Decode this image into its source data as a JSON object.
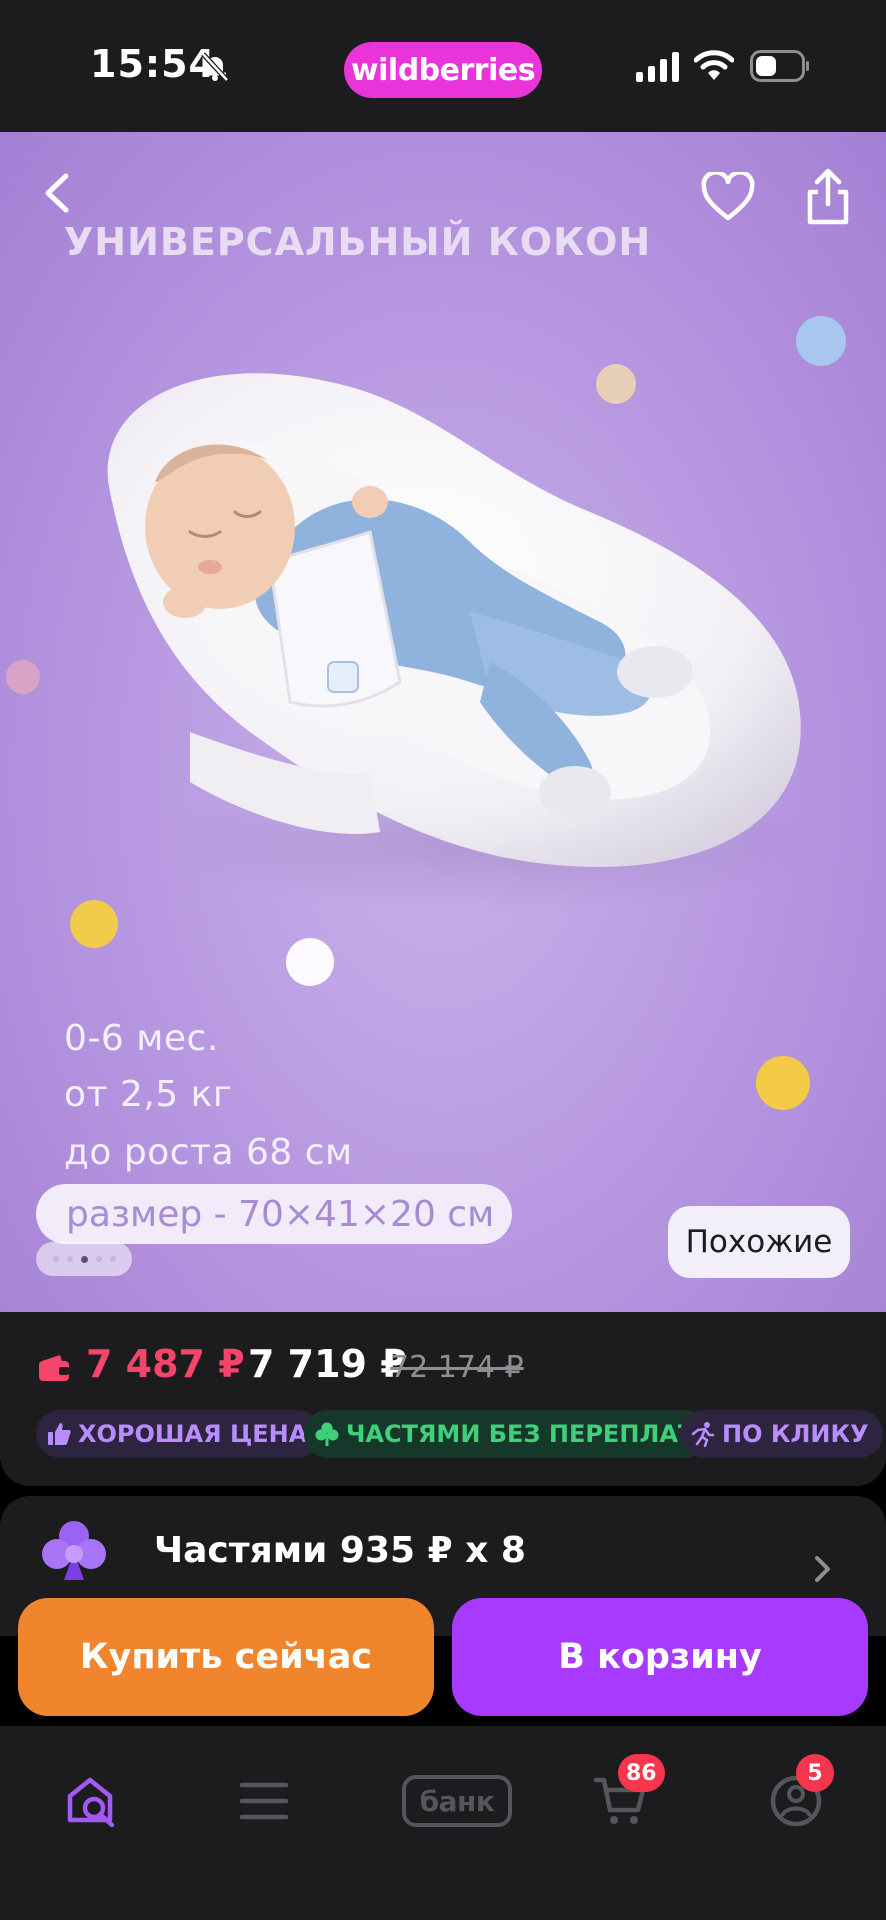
{
  "status_bar": {
    "time": "15:54",
    "brand": "wildberries",
    "brand_color": "#e834d8",
    "icons": [
      "bell-off-icon",
      "signal-icon",
      "wifi-icon",
      "battery-icon"
    ]
  },
  "hero": {
    "title": "УНИВЕРСАЛЬНЫЙ КОКОН",
    "specs": [
      "0-6 мес.",
      "от 2,5 кг",
      "до роста 68 см"
    ],
    "size": "размер - 70×41×20 см",
    "similar_label": "Похожие",
    "image_count": 5,
    "active_image": 3,
    "icons": [
      "back-icon",
      "heart-icon",
      "share-icon"
    ]
  },
  "price": {
    "wallet_price": "7 487 ₽",
    "current_price": "7 719 ₽",
    "old_price": "72 174 ₽",
    "wallet_color": "#f5456a",
    "badges": [
      {
        "label": "ХОРОШАЯ ЦЕНА",
        "icon": "thumbs-up-icon"
      },
      {
        "label": "ЧАСТЯМИ БЕЗ ПЕРЕПЛАТ",
        "icon": "clover-icon"
      },
      {
        "label": "ПО КЛИКУ",
        "icon": "runner-icon"
      }
    ]
  },
  "installments": {
    "label": "Частями 935 ₽ x 8",
    "icon": "clover-icon"
  },
  "actions": {
    "buy_now": "Купить сейчас",
    "add_to_cart": "В корзину",
    "buy_color": "#f0852e",
    "cart_color": "#a73afd"
  },
  "tabbar": {
    "items": [
      {
        "name": "home",
        "icon": "home-search-icon",
        "active": true
      },
      {
        "name": "catalog",
        "icon": "menu-icon"
      },
      {
        "name": "bank",
        "label": "банк"
      },
      {
        "name": "cart",
        "icon": "cart-icon",
        "badge": "86"
      },
      {
        "name": "profile",
        "icon": "profile-icon",
        "badge": "5"
      }
    ],
    "active_color": "#a35bf6"
  }
}
